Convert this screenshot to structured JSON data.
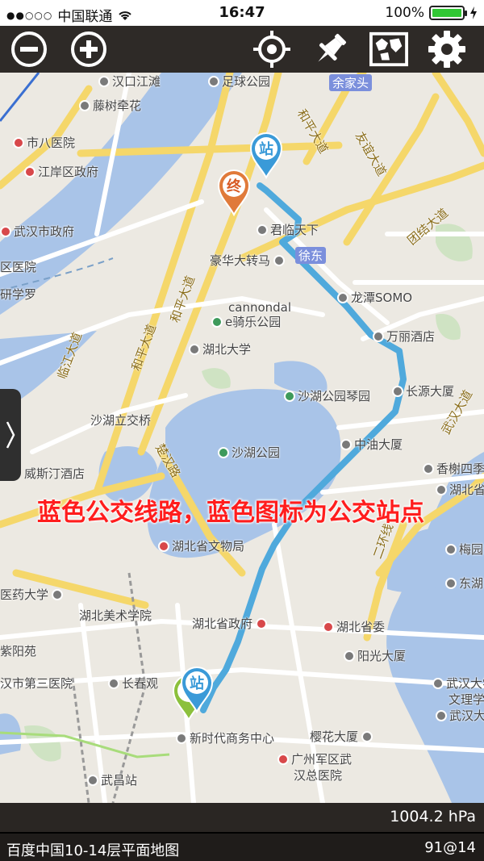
{
  "status_bar": {
    "carrier": "中国联通",
    "time": "16:47",
    "battery": "100%"
  },
  "toolbar": {
    "buttons": [
      "zoom-out-icon",
      "zoom-in-icon",
      "locate-icon",
      "pin-icon",
      "map-layers-icon",
      "settings-icon"
    ]
  },
  "map": {
    "labels": {
      "l1": "汉口江滩",
      "l2": "足球公园",
      "l3": "余家头",
      "l4": "藤树牵花",
      "l5": "市八医院",
      "l6": "江岸区政府",
      "l7": "武汉市政府",
      "l8": "区医院",
      "l9": "研学罗",
      "l10": "君临天下",
      "l11": "徐东",
      "l12": "豪华大转马",
      "l13": "龙潭SOMO",
      "l14": "cannondal",
      "l15": "e骑乐公园",
      "l16": "万丽酒店",
      "l17": "湖北大学",
      "l18": "长源大厦",
      "l19": "沙湖公园琴园",
      "l20": "沙湖立交桥",
      "l21": "中油大厦",
      "l22": "沙湖公园",
      "l23": "香榭四季",
      "l24": "威斯汀酒店",
      "l25": "湖北省",
      "l26": "湖北省文物局",
      "l27": "梅园",
      "l28": "医药大学",
      "l29": "湖北美术学院",
      "l30": "东湖",
      "l31": "湖北省政府",
      "l32": "湖北省委",
      "l33": "阳光大厦",
      "l34": "紫阳苑",
      "l35": "汉市第三医院",
      "l36": "长春观",
      "l37": "武汉大学",
      "l38": "文理学",
      "l39": "武汉大学",
      "l40": "新时代商务中心",
      "l41": "樱花大厦",
      "l42": "广州军区武",
      "l43": "汉总医院",
      "l44": "武昌站",
      "r1": "和平大道",
      "r2": "友谊大道",
      "r3": "团结大道",
      "r4": "和平大道",
      "r5": "和平大道",
      "r6": "临江大道",
      "r7": "楚汉路",
      "r8": "二环线",
      "r9": "武汉大道"
    },
    "markers": {
      "station_top": "站",
      "end": "终",
      "station_bottom": "站"
    },
    "annotation": "蓝色公交线路，蓝色图标为公交站点"
  },
  "pressure": "1004.2 hPa",
  "bottom_bar": {
    "map_source": "百度中国10-14层平面地图",
    "zoom_info": "91@14"
  },
  "colors": {
    "route": "#4fa9dc",
    "water": "#a9c4e8",
    "road_major": "#f5d76a",
    "annotation": "#ff1d1d"
  }
}
